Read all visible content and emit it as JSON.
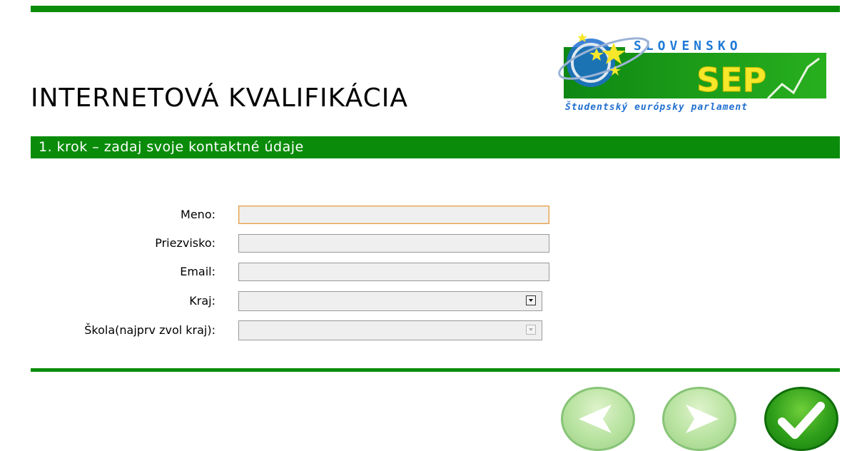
{
  "header": {
    "title": "INTERNETOVÁ KVALIFIKÁCIA",
    "logo": {
      "top_text": "SLOVENSKO",
      "main_text": "SEP",
      "subtitle": "Študentský európsky parlament"
    }
  },
  "step": {
    "label": "1. krok – zadaj svoje kontaktné údaje"
  },
  "form": {
    "meno": {
      "label": "Meno:",
      "value": ""
    },
    "priezvisko": {
      "label": "Priezvisko:",
      "value": ""
    },
    "email": {
      "label": "Email:",
      "value": ""
    },
    "kraj": {
      "label": "Kraj:",
      "selected": ""
    },
    "skola": {
      "label": "Škola(najprv zvol kraj):",
      "selected": "",
      "disabled": true
    }
  },
  "nav": {
    "buttons": [
      {
        "name": "back",
        "icon": "arrow-left-icon",
        "enabled": false
      },
      {
        "name": "next",
        "icon": "arrow-right-icon",
        "enabled": false
      },
      {
        "name": "confirm",
        "icon": "checkmark-icon",
        "enabled": true
      }
    ]
  },
  "colors": {
    "brand_green": "#0a8c0a",
    "field_bg": "#efefef",
    "focus_border": "#e0a050"
  }
}
